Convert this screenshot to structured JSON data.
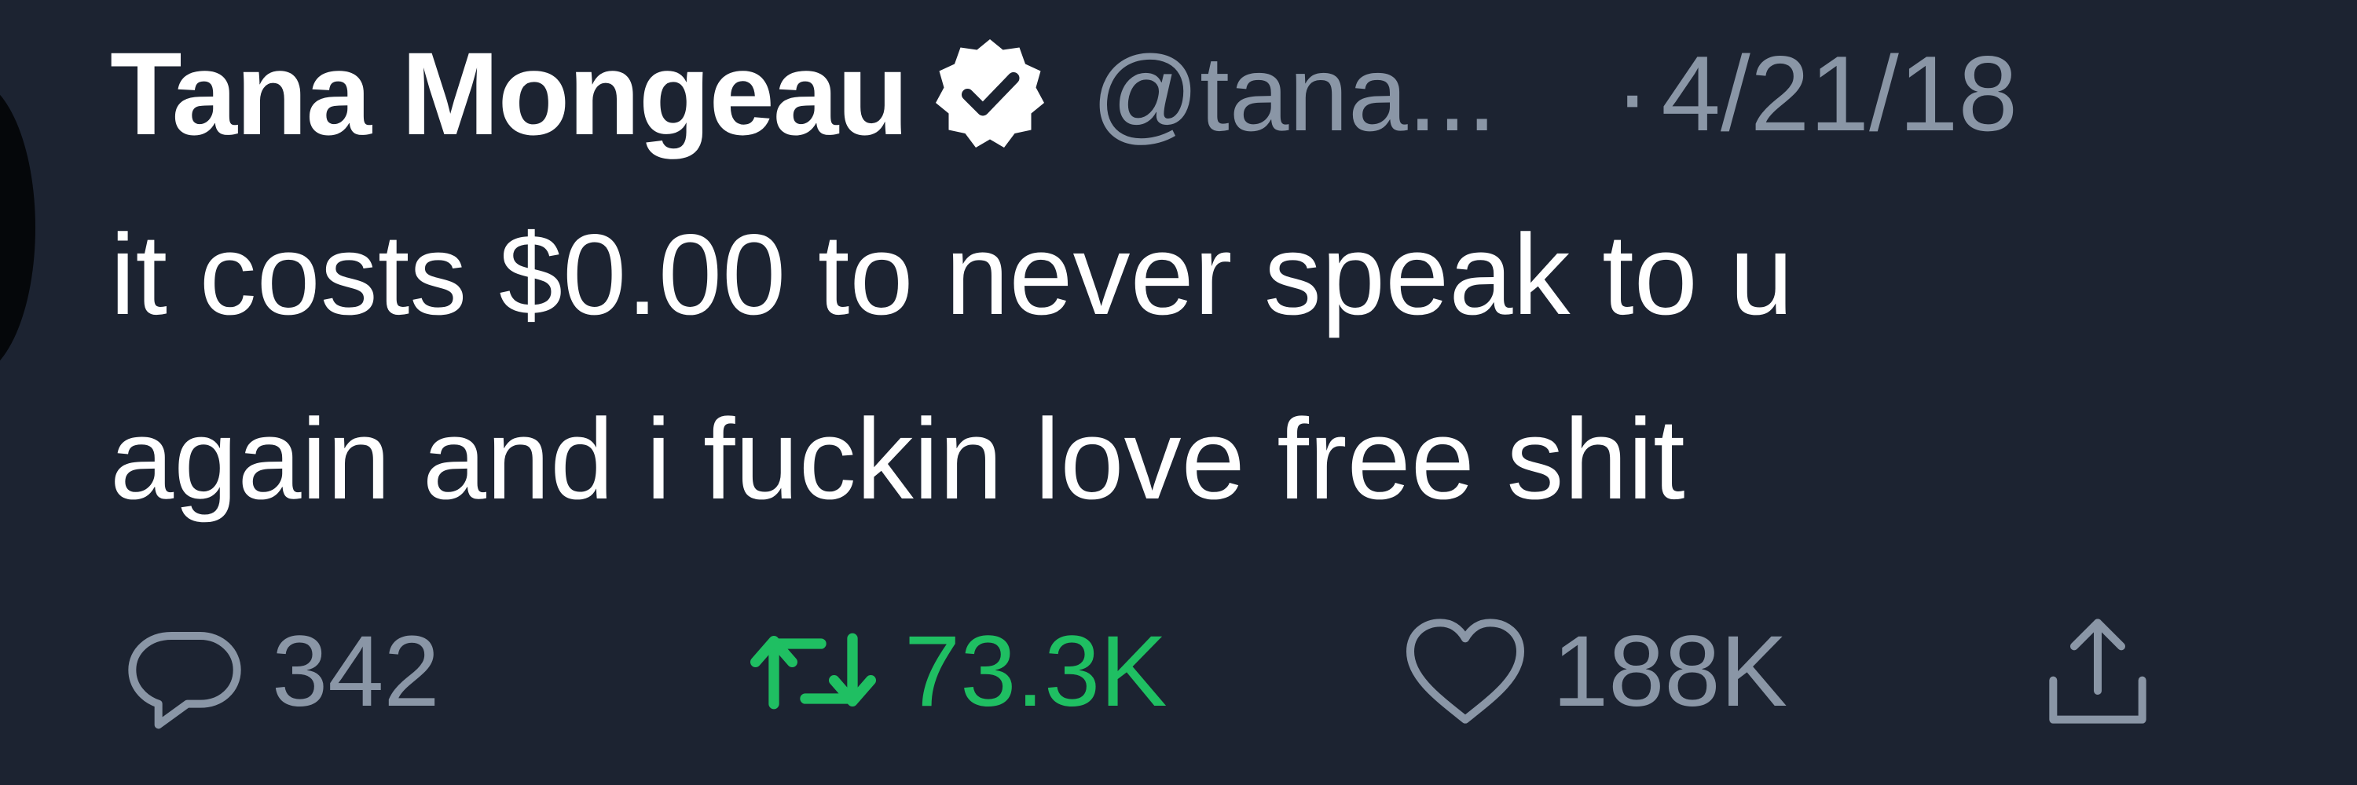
{
  "tweet": {
    "display_name": "Tana Mongeau",
    "handle": "@tana...",
    "separator": "·",
    "date": "4/21/18",
    "text_lines": [
      "it costs $0.00 to never speak to u",
      "again and i fuckin love free shit"
    ]
  },
  "actions": {
    "reply": {
      "icon": "reply-icon",
      "count": "342"
    },
    "retweet": {
      "icon": "retweet-icon",
      "count": "73.3K",
      "active_color": "#1fbf62"
    },
    "like": {
      "icon": "heart-icon",
      "count": "188K"
    },
    "share": {
      "icon": "share-icon"
    }
  },
  "colors": {
    "background": "#1c2331",
    "primary_text": "#ffffff",
    "secondary_text": "#8a96a6",
    "retweet_green": "#1fbf62"
  }
}
